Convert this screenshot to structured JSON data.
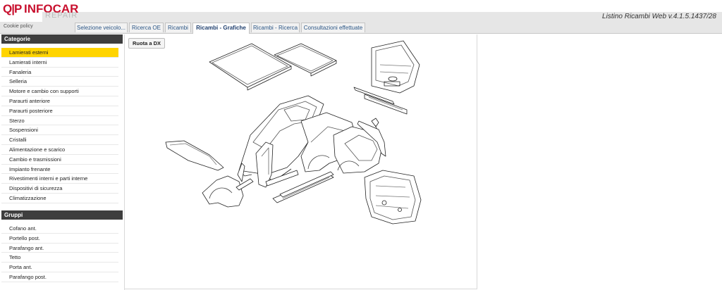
{
  "app": {
    "logo_prefix": "Q|P",
    "logo_brand": "INFOCAR",
    "logo_sub": "REPAIR",
    "version": "Listino Ricambi Web v.4.1.5.1437/28"
  },
  "tabs": {
    "cookie": "Cookie policy",
    "items": [
      {
        "label": "Selezione veicolo..."
      },
      {
        "label": "Ricerca OE"
      },
      {
        "label": "Ricambi"
      },
      {
        "label": "Ricambi - Grafiche"
      },
      {
        "label": "Ricambi - Ricerca"
      },
      {
        "label": "Consultazioni effettuate"
      }
    ],
    "active": "Ricambi - Grafiche"
  },
  "categorie": {
    "title": "Categorie",
    "items": [
      "Lamierati esterni",
      "Lamierati interni",
      "Fanaleria",
      "Selleria",
      "Motore e cambio con supporti",
      "Paraurti anteriore",
      "Paraurti posteriore",
      "Sterzo",
      "Sospensioni",
      "Cristalli",
      "Alimentazione e scarico",
      "Cambio e trasmissioni",
      "Impianto frenante",
      "Rivestimenti interni e parti interne",
      "Dispositivi di sicurezza",
      "Climatizzazione"
    ],
    "selected": "Lamierati esterni"
  },
  "gruppi": {
    "title": "Gruppi",
    "items": [
      "Cofano ant.",
      "Portello post.",
      "Parafango ant.",
      "Tetto",
      "Porta ant.",
      "Parafango post."
    ]
  },
  "main": {
    "rotate_button": "Ruota a DX"
  }
}
